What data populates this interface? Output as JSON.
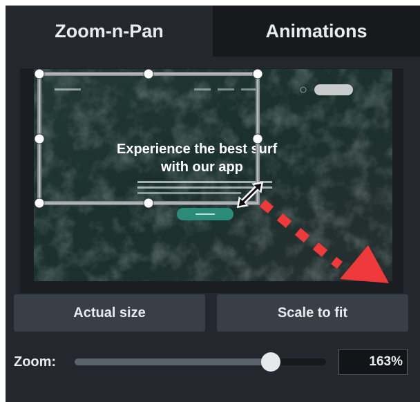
{
  "tabs": [
    {
      "label": "Zoom-n-Pan",
      "active": true
    },
    {
      "label": "Animations",
      "active": false
    }
  ],
  "preview": {
    "headline_line1": "Experience the best surf",
    "headline_line2": "with our app",
    "nav_button_label": "",
    "cta_label": ""
  },
  "buttons": {
    "actual_size": "Actual size",
    "scale_to_fit": "Scale to fit"
  },
  "zoom": {
    "label": "Zoom:",
    "value_text": "163%",
    "slider_level": 0.78
  },
  "colors": {
    "panel_bg": "#24282e",
    "inactive_tab_bg": "#17191d",
    "button_bg": "#393f47",
    "arrow_red": "#f0393a",
    "teal_button": "#2a8c78",
    "water_dark": "#1e3a36"
  },
  "icons": {
    "resize_cursor": "diagonal-resize-icon",
    "drag_arrow": "red-dotted-arrow-icon"
  }
}
